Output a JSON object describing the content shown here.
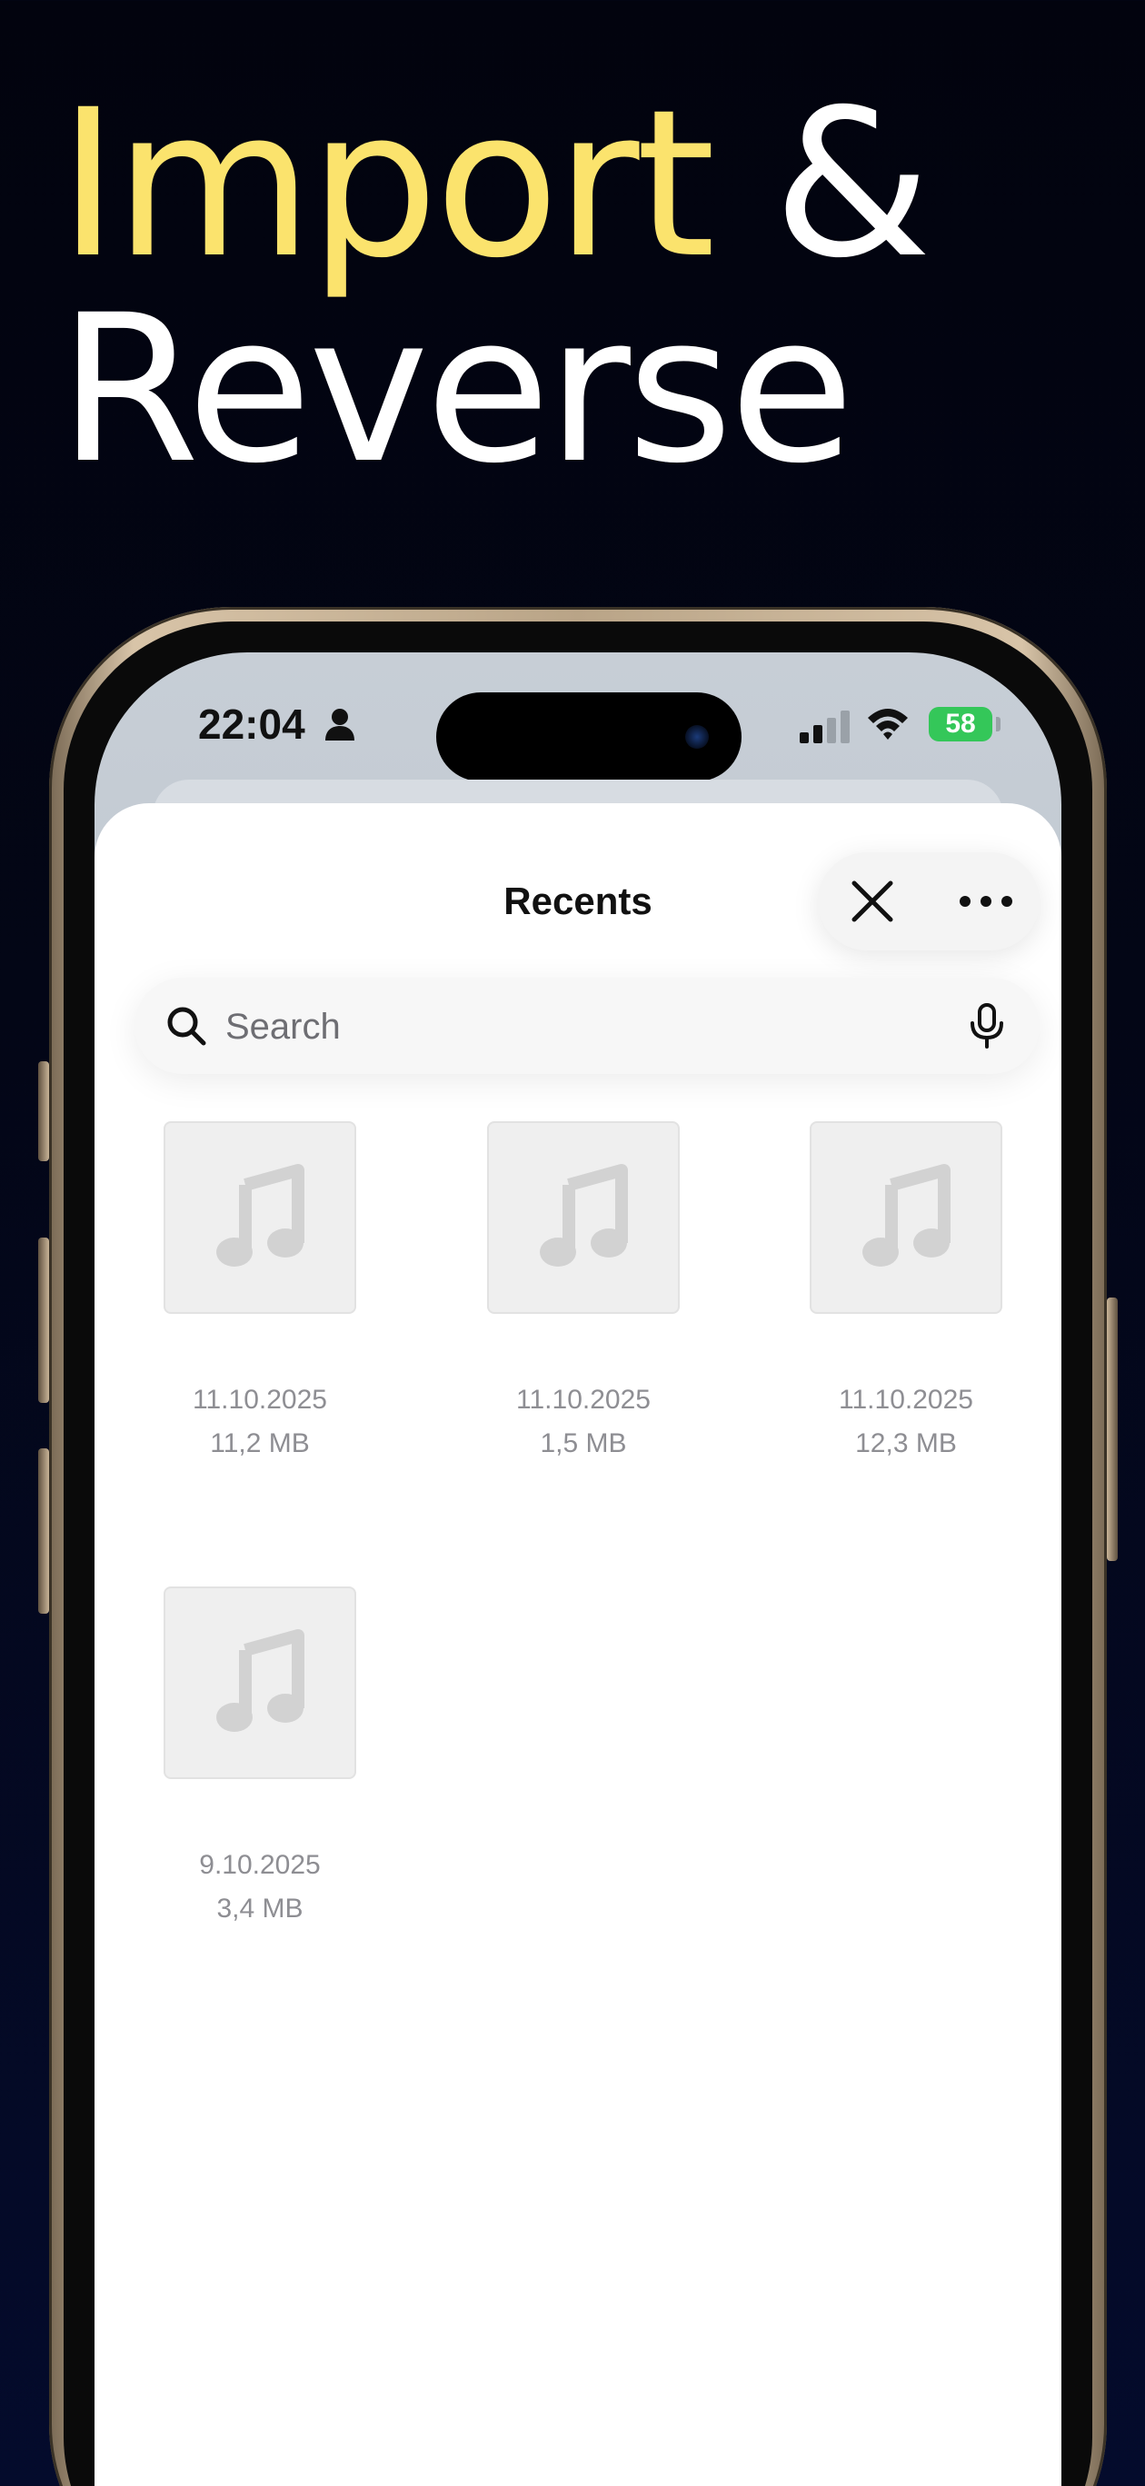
{
  "headline": {
    "word1": "Import",
    "word2": "&",
    "line2": "Reverse",
    "accent_color": "#fbe36d",
    "text_color": "#ffffff"
  },
  "status_bar": {
    "time": "22:04",
    "battery_percent": "58",
    "battery_color": "#34c759",
    "icons": [
      "person-icon",
      "signal-icon",
      "wifi-icon",
      "battery-icon"
    ]
  },
  "sheet": {
    "title": "Recents",
    "close_icon": "close-icon",
    "more_icon": "more-icon"
  },
  "search": {
    "placeholder": "Search",
    "value": "",
    "icons": [
      "search-icon",
      "mic-icon"
    ]
  },
  "files": [
    {
      "name": "",
      "date": "11.10.2025",
      "size": "11,2 MB",
      "icon": "music-note-icon"
    },
    {
      "name": "",
      "date": "11.10.2025",
      "size": "1,5 MB",
      "icon": "music-note-icon"
    },
    {
      "name": "",
      "date": "11.10.2025",
      "size": "12,3 MB",
      "icon": "music-note-icon"
    },
    {
      "name": "",
      "date": "9.10.2025",
      "size": "3,4 MB",
      "icon": "music-note-icon"
    }
  ]
}
